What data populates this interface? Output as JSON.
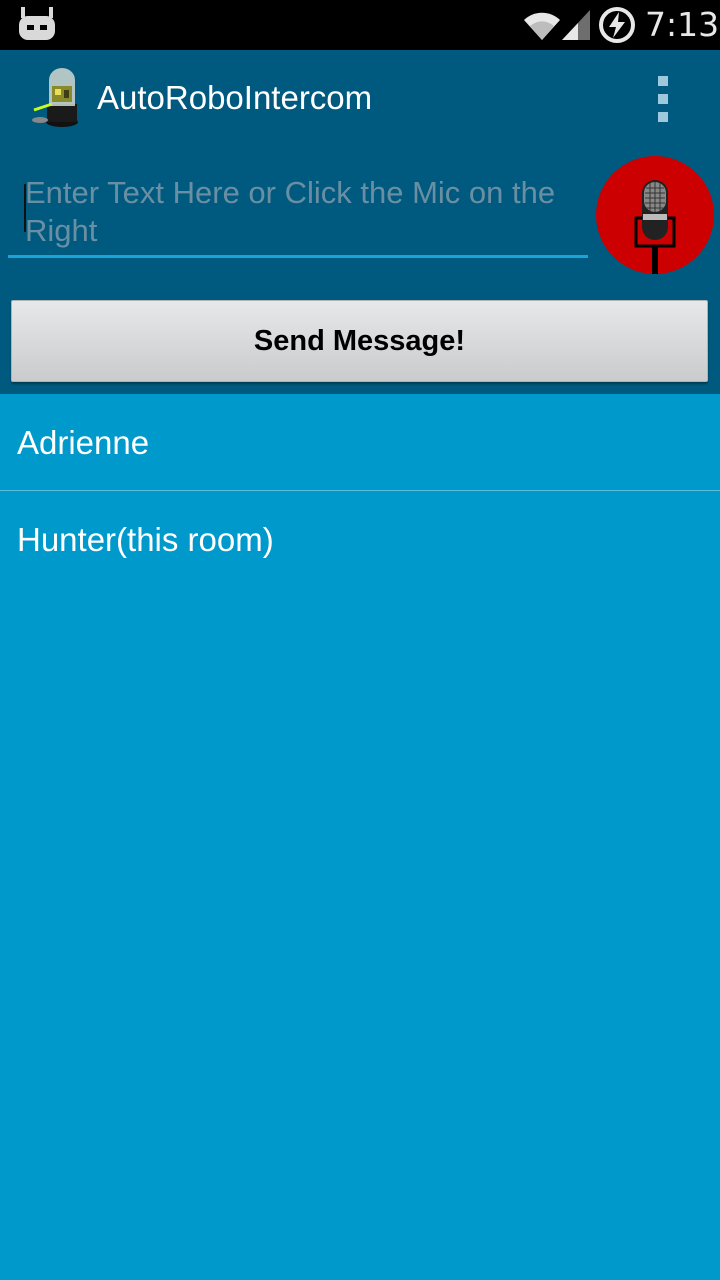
{
  "status_bar": {
    "time": "7:13",
    "icons": [
      "cyanogenmod-icon",
      "wifi-icon",
      "signal-icon",
      "battery-charging-icon"
    ]
  },
  "app_bar": {
    "title": "AutoRoboIntercom",
    "logo_icon": "robot-logo-icon",
    "menu_icon": "overflow-menu-icon"
  },
  "compose": {
    "placeholder": "Enter Text Here or Click the Mic on the Right",
    "value": "",
    "mic_icon": "microphone-icon",
    "mic_color": "#cc0000",
    "send_label": "Send Message!"
  },
  "rooms": {
    "items": [
      {
        "label": "Adrienne"
      },
      {
        "label": "Hunter(this room)"
      }
    ]
  },
  "colors": {
    "header_bg": "#005a80",
    "list_bg": "#0099cc",
    "accent": "#1aa3d9"
  }
}
